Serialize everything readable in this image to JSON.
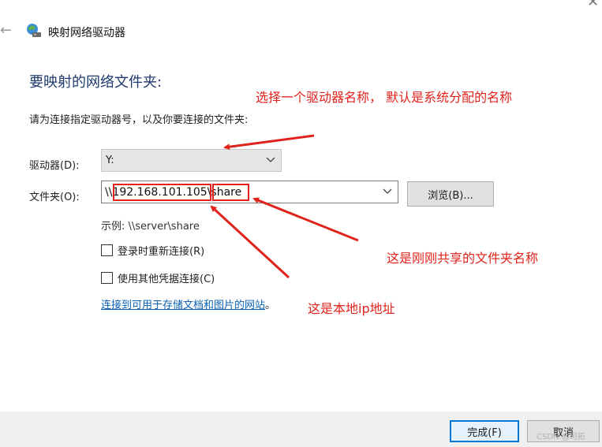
{
  "window": {
    "title": "映射网络驱动器"
  },
  "heading": "要映射的网络文件夹:",
  "instruction": "请为连接指定驱动器号，以及你要连接的文件夹:",
  "drive": {
    "label": "驱动器(D):",
    "selected": "Y:"
  },
  "folder": {
    "label": "文件夹(O):",
    "value_prefix": "\\\\",
    "value_ip": "192.168.101.105",
    "value_sep": "\\",
    "value_share": "share",
    "browse_label": "浏览(B)..."
  },
  "example": "示例: \\\\server\\share",
  "options": {
    "reconnect_label": "登录时重新连接(R)",
    "other_credentials_label": "使用其他凭据连接(C)"
  },
  "link": {
    "text": "连接到可用于存储文档和图片的网站",
    "suffix": "。"
  },
  "annotations": {
    "drive_note": "选择一个驱动器名称， 默认是系统分配的名称",
    "share_note": "这是刚刚共享的文件夹名称",
    "ip_note": "这是本地ip地址"
  },
  "footer": {
    "finish_label": "完成(F)",
    "cancel_label": "取消"
  },
  "watermark": "CSDN @司拓",
  "colors": {
    "annotation": "#e0231c",
    "link": "#0b61b4",
    "heading": "#1e3a6e",
    "primary_border": "#0078d7"
  },
  "icons": {
    "back": "back-arrow-icon",
    "app": "network-drive-icon",
    "dropdown": "chevron-down-icon",
    "close": "close-icon"
  }
}
